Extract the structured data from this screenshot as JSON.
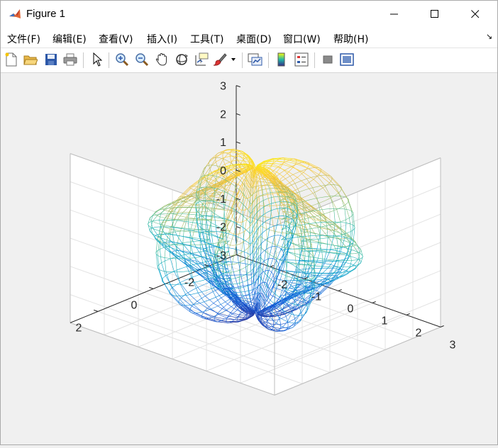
{
  "window": {
    "title": "Figure 1"
  },
  "menubar": {
    "items": [
      "文件(F)",
      "编辑(E)",
      "查看(V)",
      "插入(I)",
      "工具(T)",
      "桌面(D)",
      "窗口(W)",
      "帮助(H)"
    ],
    "overflow_arrow": "↘"
  },
  "toolbar": {
    "buttons": [
      "new-figure",
      "open-file",
      "save-figure",
      "print-figure",
      "edit-plot",
      "zoom-in",
      "zoom-out",
      "pan",
      "rotate-3d",
      "data-cursor",
      "brush",
      "link-plot",
      "colorbar",
      "legend",
      "hide-plot-tools",
      "show-plot-tools"
    ]
  },
  "chart_data": {
    "type": "mesh",
    "description_source": "3-D wireframe surface (petal-like), colored by z with parula colormap",
    "axes": {
      "x": {
        "ticks": [
          -2,
          -1,
          0,
          1,
          2,
          3
        ],
        "tick_labels": [
          "-2",
          "-1",
          "0",
          "1",
          "2",
          "3"
        ]
      },
      "y": {
        "ticks": [
          -2,
          0,
          2
        ],
        "tick_labels": [
          "-2",
          "0",
          "2"
        ]
      },
      "z": {
        "ticks": [
          -3,
          -2,
          -1,
          0,
          1,
          2,
          3
        ],
        "tick_labels": [
          "-3",
          "-2",
          "-1",
          "0",
          "1",
          "2",
          "3"
        ]
      },
      "zlim": [
        -3,
        3
      ]
    },
    "grid": true,
    "box": true,
    "colormap": [
      "#352a87",
      "#0f5cdd",
      "#1481d6",
      "#06a4ca",
      "#2eb7a4",
      "#87bf77",
      "#d1bb59",
      "#fec832",
      "#f9fb0e"
    ],
    "title": "",
    "xlabel": "",
    "ylabel": "",
    "zlabel": ""
  }
}
